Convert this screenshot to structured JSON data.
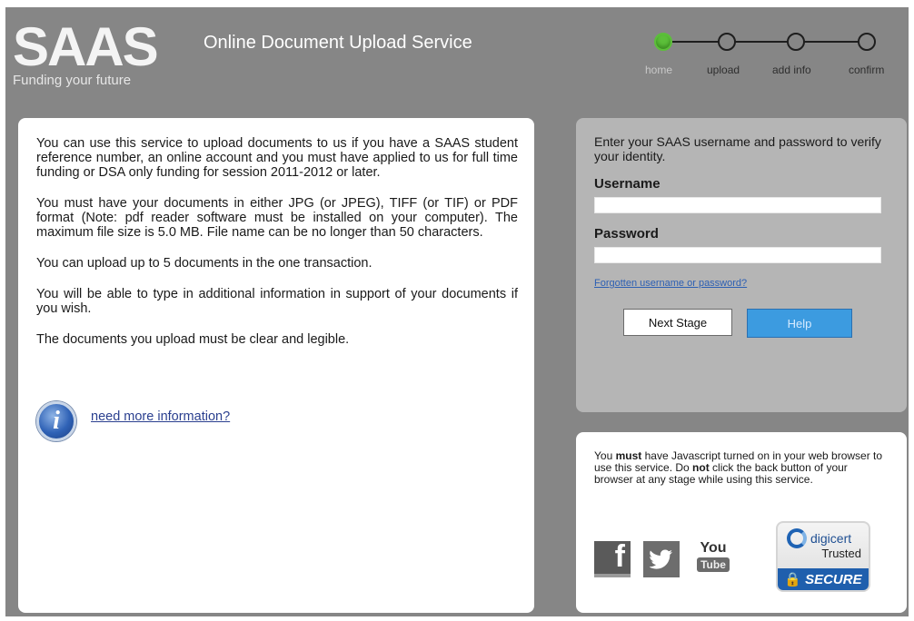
{
  "header": {
    "logo_word": "SAAS",
    "logo_tagline": "Funding your future",
    "service_title": "Online Document Upload Service"
  },
  "steps": [
    {
      "label": "home",
      "active": true
    },
    {
      "label": "upload",
      "active": false
    },
    {
      "label": "add info",
      "active": false
    },
    {
      "label": "confirm",
      "active": false
    }
  ],
  "main": {
    "paragraphs": [
      "You can use this service to upload documents to us if you have a SAAS student reference number, an online account and you must have applied to us for full time funding or DSA only funding for session 2011-2012 or later.",
      "You must have your documents in either JPG (or JPEG), TIFF (or TIF) or PDF format (Note: pdf reader software must be installed on your computer). The maximum file size is 5.0 MB. File name can be no longer than 50 characters.",
      "You can upload up to 5 documents in the one transaction.",
      "You will be able to type in additional information in support of your documents if you wish.",
      "The documents you upload must be clear and legible."
    ],
    "info_link": "need more information?"
  },
  "login": {
    "intro": "Enter your SAAS username and password to verify your identity.",
    "username_label": "Username",
    "username_value": "",
    "password_label": "Password",
    "password_value": "",
    "forgot_link": "Forgotten username or password?",
    "next_button": "Next Stage",
    "help_button": "Help"
  },
  "notice": {
    "pre1": "You ",
    "bold1": "must",
    "mid": " have Javascript turned on in your web browser to use this service. Do ",
    "bold2": "not",
    "post": " click the back button of your browser at any stage while using this service."
  },
  "badges": {
    "facebook": "f",
    "youtube_top": "You",
    "youtube_bottom": "Tube",
    "digicert_name": "digicert",
    "digicert_trusted": "Trusted",
    "digicert_secure": "SECURE"
  },
  "colors": {
    "frame": "#868686",
    "active_step": "#5cbf3a",
    "help_button": "#3c9be0"
  }
}
